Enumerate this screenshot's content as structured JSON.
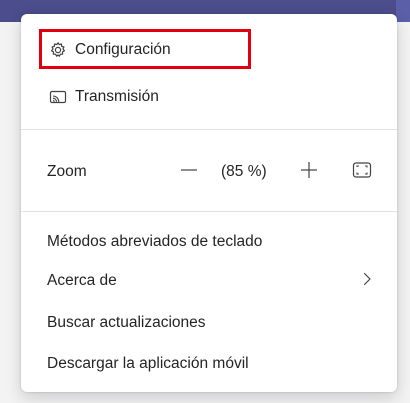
{
  "menu": {
    "items_top": [
      {
        "label": "Configuración",
        "icon": "gear-icon"
      },
      {
        "label": "Transmisión",
        "icon": "cast-icon"
      }
    ],
    "zoom": {
      "label": "Zoom",
      "value": "(85 %)",
      "decrease_icon": "minus-icon",
      "increase_icon": "plus-icon",
      "fullscreen_icon": "fullscreen-icon"
    },
    "items_bottom": [
      {
        "label": "Métodos abreviados de teclado"
      },
      {
        "label": "Acerca de",
        "icon": "chevron-right-icon"
      },
      {
        "label": "Buscar actualizaciones"
      },
      {
        "label": "Descargar la aplicación móvil"
      }
    ]
  },
  "colors": {
    "highlight": "#e1000f",
    "header": "#4b4d8c"
  }
}
